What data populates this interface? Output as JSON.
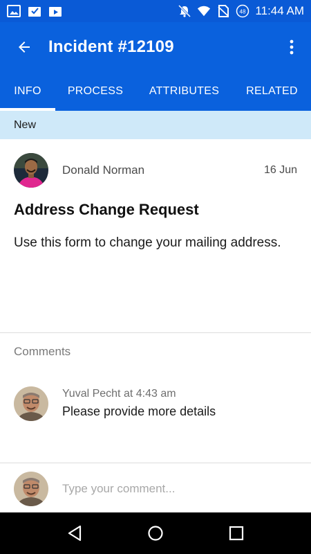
{
  "status_bar": {
    "time": "11:44 AM",
    "left_icons": [
      "image-notification-icon",
      "download-notification-icon",
      "upload-notification-icon"
    ],
    "right_icons": [
      "notifications-off-icon",
      "wifi-icon",
      "no-sim-icon",
      "battery-icon"
    ],
    "battery_level": "48"
  },
  "app_bar": {
    "title": "Incident #12109",
    "back_icon": "arrow-back-icon",
    "menu_icon": "more-vert-icon"
  },
  "tabs": [
    {
      "label": "INFO",
      "active": true
    },
    {
      "label": "PROCESS",
      "active": false
    },
    {
      "label": "ATTRIBUTES",
      "active": false
    },
    {
      "label": "RELATED",
      "active": false
    }
  ],
  "state": "New",
  "incident": {
    "author": "Donald Norman",
    "date": "16 Jun",
    "title": "Address Change Request",
    "description": "Use this form to change your mailing address."
  },
  "comments": {
    "label": "Comments",
    "items": [
      {
        "meta": "Yuval Pecht at 4:43 am",
        "text": "Please provide more details"
      }
    ]
  },
  "composer": {
    "placeholder": "Type your comment..."
  },
  "colors": {
    "primary": "#0a61dd",
    "status_bar": "#0a5ad6",
    "state_strip": "#cfe9f9"
  }
}
